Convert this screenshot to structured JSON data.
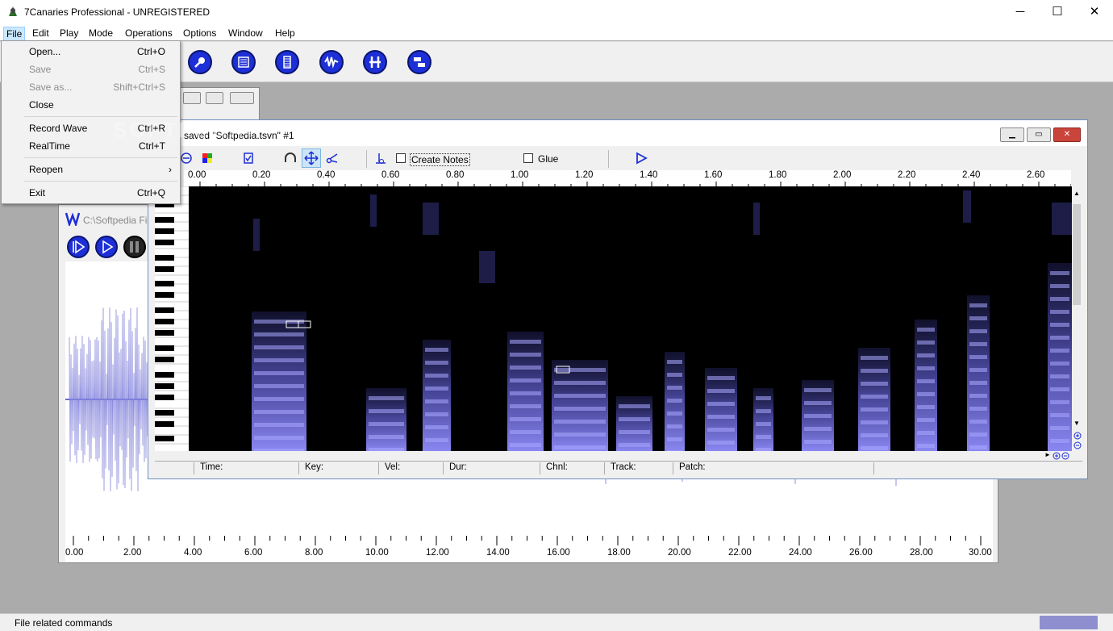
{
  "window": {
    "title": "7Canaries Professional - UNREGISTERED",
    "min": "─",
    "max": "☐",
    "close": "✕"
  },
  "menubar": [
    "File",
    "Edit",
    "Play",
    "Mode",
    "Operations",
    "Options",
    "Window",
    "Help"
  ],
  "file_menu": [
    {
      "label": "Open...",
      "shortcut": "Ctrl+O",
      "enabled": true
    },
    {
      "label": "Save",
      "shortcut": "Ctrl+S",
      "enabled": false
    },
    {
      "label": "Save as...",
      "shortcut": "Shift+Ctrl+S",
      "enabled": false
    },
    {
      "label": "Close",
      "shortcut": "",
      "enabled": true
    },
    {
      "label": "Record Wave",
      "shortcut": "Ctrl+R",
      "enabled": true
    },
    {
      "label": "RealTime",
      "shortcut": "Ctrl+T",
      "enabled": true
    },
    {
      "label": "Reopen",
      "shortcut": "›",
      "enabled": true
    },
    {
      "label": "Exit",
      "shortcut": "Ctrl+Q",
      "enabled": true
    }
  ],
  "spectro_window": {
    "title": "saved \"Softpedia.tsvn\" #1",
    "create_notes": "Create Notes",
    "glue": "Glue",
    "ruler": [
      "0.00",
      "0.20",
      "0.40",
      "0.60",
      "0.80",
      "1.00",
      "1.20",
      "1.40",
      "1.60",
      "1.80",
      "2.00",
      "2.20",
      "2.40",
      "2.60"
    ],
    "status_fields": [
      "Time:",
      "Key:",
      "Vel:",
      "Dur:",
      "Chnl:",
      "Track:",
      "Patch:"
    ]
  },
  "wave_window": {
    "title": "C:\\Softpedia Fi",
    "ruler": [
      "0.00",
      "2.00",
      "4.00",
      "6.00",
      "8.00",
      "10.00",
      "12.00",
      "14.00",
      "16.00",
      "18.00",
      "20.00",
      "22.00",
      "24.00",
      "26.00",
      "28.00",
      "30.00"
    ]
  },
  "statusbar": {
    "text": "File related commands"
  },
  "watermark": "SOFTPEDIA",
  "colors": {
    "accent": "#1d2fd6",
    "spectrum": "#8a87f2",
    "wave": "#8f8fe6"
  }
}
